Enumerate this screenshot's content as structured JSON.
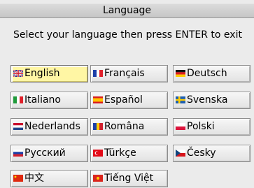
{
  "dialog": {
    "title": "Language",
    "prompt": "Select your language then press ENTER to exit"
  },
  "languages": [
    {
      "label": "English",
      "flag": "uk-flag-icon",
      "selected": true
    },
    {
      "label": "Français",
      "flag": "france-flag-icon",
      "selected": false
    },
    {
      "label": "Deutsch",
      "flag": "germany-flag-icon",
      "selected": false
    },
    {
      "label": "Italiano",
      "flag": "italy-flag-icon",
      "selected": false
    },
    {
      "label": "Español",
      "flag": "spain-flag-icon",
      "selected": false
    },
    {
      "label": "Svenska",
      "flag": "sweden-flag-icon",
      "selected": false
    },
    {
      "label": "Nederlands",
      "flag": "netherlands-flag-icon",
      "selected": false
    },
    {
      "label": "Româna",
      "flag": "romania-flag-icon",
      "selected": false
    },
    {
      "label": "Polski",
      "flag": "poland-flag-icon",
      "selected": false
    },
    {
      "label": "Русский",
      "flag": "russia-flag-icon",
      "selected": false
    },
    {
      "label": "Türkçe",
      "flag": "turkey-flag-icon",
      "selected": false
    },
    {
      "label": "Česky",
      "flag": "czech-flag-icon",
      "selected": false
    },
    {
      "label": "中文",
      "flag": "china-flag-icon",
      "selected": false
    },
    {
      "label": "Tiếng Việt",
      "flag": "vietnam-flag-icon",
      "selected": false
    }
  ],
  "colors": {
    "selected_background": "#fff6a4",
    "button_background": "#eeeeee",
    "titlebar": "#d2d2d2"
  }
}
